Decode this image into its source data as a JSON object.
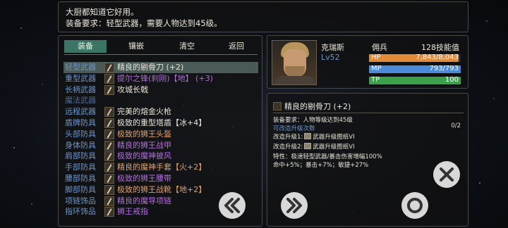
{
  "description": {
    "line1": "大厨都知道它好用。",
    "line2": "装备要求：轻型武器，需要人物达到45级。"
  },
  "tabs": [
    {
      "label": "装备"
    },
    {
      "label": "镶嵌"
    },
    {
      "label": "清空"
    },
    {
      "label": "返回"
    }
  ],
  "slots": [
    {
      "label": "轻型武器",
      "item": "精良的剔骨刀 (+2)",
      "item_color": "#e8e4d8",
      "selected": true,
      "has_icon": true
    },
    {
      "label": "重型武器",
      "item": "提尔之锋(刹刚)【地】 (+3)",
      "item_color": "#b070d8",
      "selected": false,
      "has_icon": true
    },
    {
      "label": "长柄武器",
      "item": "攻城长戟",
      "item_color": "#e8e4d8",
      "selected": false,
      "has_icon": true
    },
    {
      "label": "魔法武器",
      "item": "",
      "item_color": "#e8e4d8",
      "selected": false,
      "has_icon": false
    },
    {
      "label": "远程武器",
      "item": "完美的熔金火枪",
      "item_color": "#e8e4d8",
      "selected": false,
      "has_icon": true
    },
    {
      "label": "盾牌防具",
      "item": "极致的重型塔盾【冰+4】",
      "item_color": "#e8e4d8",
      "selected": false,
      "has_icon": true
    },
    {
      "label": "头部防具",
      "item": "极致的狮王头盔",
      "item_color": "#e0a070",
      "selected": false,
      "has_icon": true
    },
    {
      "label": "身体防具",
      "item": "精良的狮王战甲",
      "item_color": "#b070d8",
      "selected": false,
      "has_icon": true
    },
    {
      "label": "肩部防具",
      "item": "极致的魔神披风",
      "item_color": "#b070d8",
      "selected": false,
      "has_icon": true
    },
    {
      "label": "手部防具",
      "item": "精良的魔神手套【火+2】",
      "item_color": "#e0a070",
      "selected": false,
      "has_icon": true
    },
    {
      "label": "腰部防具",
      "item": "极致的狮王腰带",
      "item_color": "#b070d8",
      "selected": false,
      "has_icon": true
    },
    {
      "label": "脚部防具",
      "item": "极致的狮王战靴【地+2】",
      "item_color": "#e0a070",
      "selected": false,
      "has_icon": true
    },
    {
      "label": "项链饰品",
      "item": "精良的魔导项链",
      "item_color": "#b070d8",
      "selected": false,
      "has_icon": true
    },
    {
      "label": "指环饰品",
      "item": "狮王戒指",
      "item_color": "#b070d8",
      "selected": false,
      "has_icon": true
    }
  ],
  "character": {
    "name": "克瑞斯",
    "level": "Lv52",
    "class": "佣兵",
    "skill_points": "128技能值",
    "hp": {
      "label": "HP",
      "value": "7,843/8,043",
      "fraction": 0.975,
      "color": "#e08a3a"
    },
    "mp": {
      "label": "MP",
      "value": "793/793",
      "fraction": 1.0,
      "color": "#4a8ad8"
    },
    "tp": {
      "label": "TP",
      "value": "100",
      "fraction": 1.0,
      "color": "#3aa04a"
    }
  },
  "item_detail": {
    "title": "精良的剔骨刀 (+2)",
    "requirement": "装备要求：人物等级达到45级",
    "upgrade_label": "可改造升级次数",
    "upgrade_count": "0/2",
    "upgrade1_prefix": "改造升级1:",
    "upgrade1_name": "武器升级图纸VI",
    "upgrade2_prefix": "改造升级2:",
    "upgrade2_name": "武器升级图纸VI",
    "trait": "特性：极速轻型武器/暴击伤害增幅100%",
    "stats": "命中+5%；暴击+7%；敏捷+27%"
  },
  "buttons": {
    "back": "double-chevron-left-icon",
    "forward": "double-chevron-right-icon",
    "confirm": "circle-icon",
    "close": "x-icon"
  }
}
